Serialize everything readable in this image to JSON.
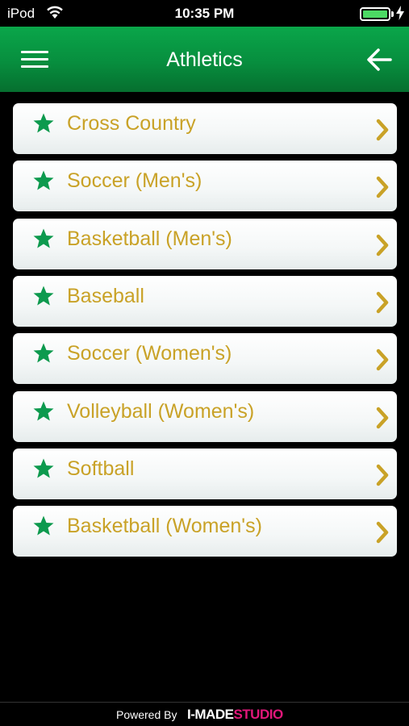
{
  "status_bar": {
    "carrier": "iPod",
    "time": "10:35 PM",
    "battery_color": "#4cd964"
  },
  "nav": {
    "title": "Athletics",
    "menu_icon": "hamburger-icon",
    "back_icon": "back-arrow-icon"
  },
  "sports": [
    {
      "label": "Cross Country"
    },
    {
      "label": "Soccer (Men's)"
    },
    {
      "label": "Basketball (Men's)"
    },
    {
      "label": "Baseball"
    },
    {
      "label": "Soccer (Women's)"
    },
    {
      "label": "Volleyball (Women's)"
    },
    {
      "label": "Softball"
    },
    {
      "label": "Basketball (Women's)"
    }
  ],
  "footer": {
    "powered_by": "Powered By",
    "brand_part1": "I-MADE",
    "brand_part2": "STUDIO"
  },
  "colors": {
    "nav_green": "#078e3e",
    "star_green": "#0d9a4e",
    "label_gold": "#c9a227",
    "brand_pink": "#e2177a"
  }
}
